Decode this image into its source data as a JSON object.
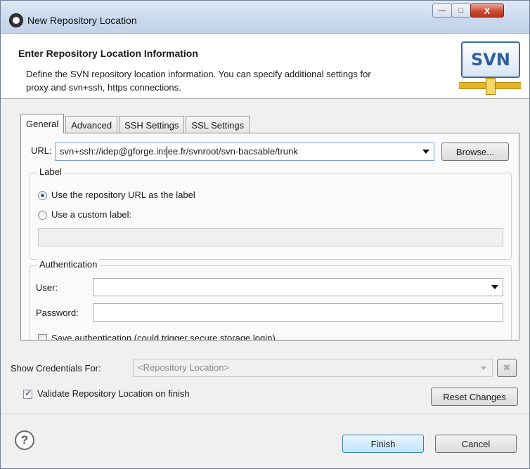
{
  "window": {
    "title": "New Repository Location",
    "minimize_label": "—",
    "maximize_label": "□",
    "close_label": "X"
  },
  "header": {
    "title": "Enter Repository Location Information",
    "description": "Define the SVN repository location information. You can specify additional settings for proxy and svn+ssh, https connections.",
    "logo_text": "SVN"
  },
  "tabs": [
    {
      "label": "General",
      "active": true
    },
    {
      "label": "Advanced",
      "active": false
    },
    {
      "label": "SSH Settings",
      "active": false
    },
    {
      "label": "SSL Settings",
      "active": false
    }
  ],
  "general": {
    "url_label": "URL:",
    "url_value": "svn+ssh://idep@gforge.insee.fr/svnroot/svn-bacsable/trunk",
    "browse_label": "Browse...",
    "label_group": {
      "legend": "Label",
      "option_repo": "Use the repository URL as the label",
      "option_custom": "Use a custom label:",
      "selected": "repo",
      "custom_value": ""
    },
    "auth_group": {
      "legend": "Authentication",
      "user_label": "User:",
      "user_value": "",
      "password_label": "Password:",
      "password_value": "",
      "save_auth_label": "Save authentication (could trigger secure storage login)"
    }
  },
  "credentials": {
    "label": "Show Credentials For:",
    "value": "<Repository Location>"
  },
  "validate": {
    "label": "Validate Repository Location on finish",
    "checked": true
  },
  "buttons": {
    "reset": "Reset Changes",
    "finish": "Finish",
    "cancel": "Cancel",
    "help": "?"
  }
}
